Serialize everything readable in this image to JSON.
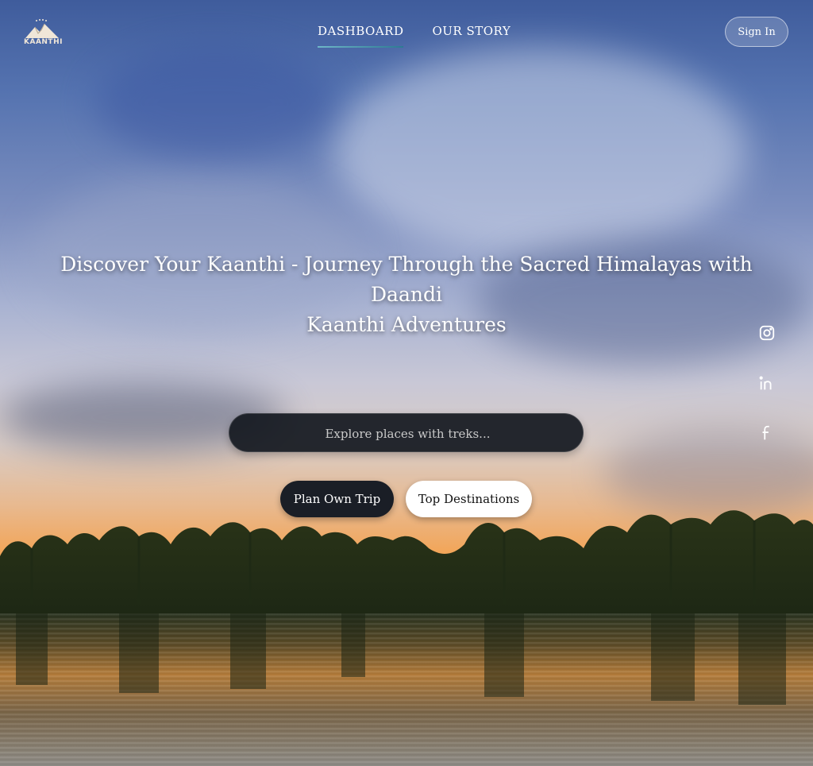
{
  "brand": {
    "logo_text": "KAANTHI"
  },
  "nav": {
    "items": [
      {
        "label": "DASHBOARD",
        "active": true
      },
      {
        "label": "OUR STORY",
        "active": false
      }
    ],
    "signin_label": "Sign In"
  },
  "hero": {
    "headline_line1": "Discover Your Kaanthi - Journey Through the Sacred Himalayas with Daandi",
    "headline_line2": "Kaanthi Adventures",
    "search_placeholder": "Explore places with treks...",
    "search_value": "",
    "buttons": {
      "plan": "Plan Own Trip",
      "destinations": "Top Destinations"
    }
  },
  "social": {
    "icons": [
      "instagram-icon",
      "linkedin-icon",
      "facebook-icon"
    ]
  },
  "colors": {
    "accent_underline": "#2e7a93",
    "dark_button": "#1a1e26",
    "light_button": "#ffffff"
  }
}
